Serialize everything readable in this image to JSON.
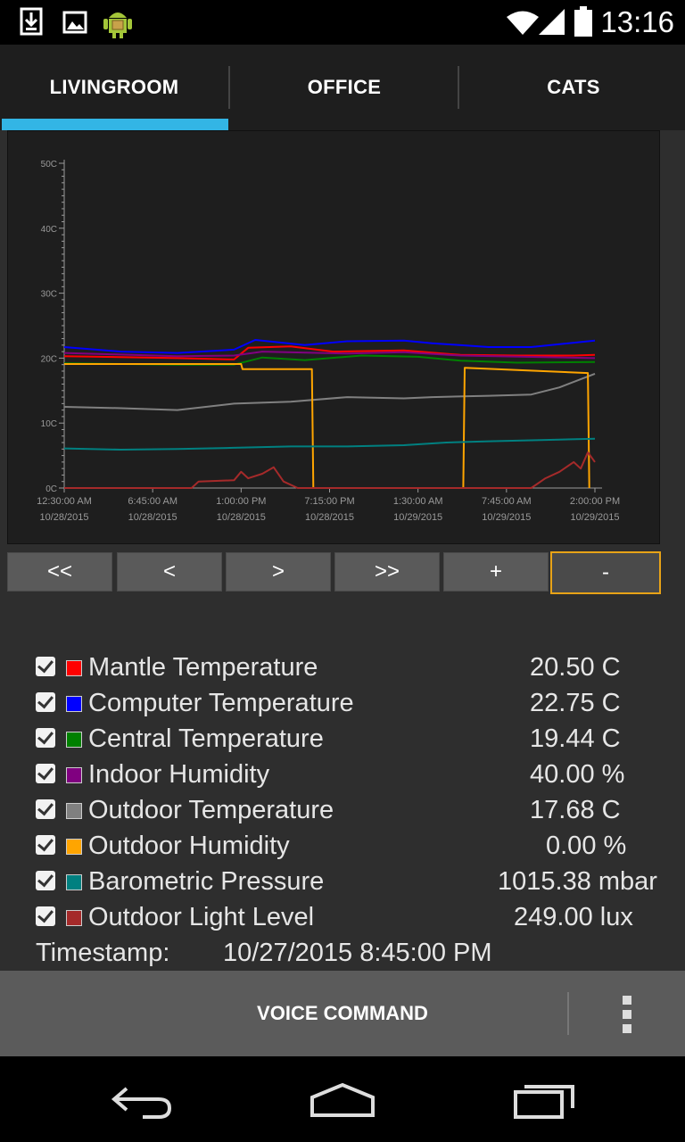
{
  "status_bar": {
    "time": "13:16",
    "left_icons": [
      "download-icon",
      "image-icon",
      "android-icon"
    ],
    "right_icons": [
      "wifi-icon",
      "signal-icon",
      "battery-icon"
    ]
  },
  "tabs": [
    {
      "label": "LIVINGROOM",
      "selected": true
    },
    {
      "label": "OFFICE",
      "selected": false
    },
    {
      "label": "CATS",
      "selected": false
    }
  ],
  "accent_color": "#33b5e5",
  "chart_data": {
    "type": "line",
    "ylim": [
      0,
      50
    ],
    "y_ticks": [
      "0C",
      "10C",
      "20C",
      "30C",
      "40C",
      "50C"
    ],
    "x_ticks": [
      [
        "12:30:00 AM",
        "10/28/2015"
      ],
      [
        "6:45:00 AM",
        "10/28/2015"
      ],
      [
        "1:00:00 PM",
        "10/28/2015"
      ],
      [
        "7:15:00 PM",
        "10/28/2015"
      ],
      [
        "1:30:00 AM",
        "10/29/2015"
      ],
      [
        "7:45:00 AM",
        "10/29/2015"
      ],
      [
        "2:00:00 PM",
        "10/29/2015"
      ]
    ],
    "x_hours": [
      0,
      6.25,
      12.5,
      18.75,
      25,
      31.25,
      37.5
    ],
    "series": [
      {
        "name": "Mantle Temperature",
        "color": "#ff0000",
        "points": [
          [
            0,
            20.3
          ],
          [
            8,
            20
          ],
          [
            12,
            19.8
          ],
          [
            13,
            21.6
          ],
          [
            16,
            21.8
          ],
          [
            19,
            21
          ],
          [
            24,
            21.2
          ],
          [
            28,
            20.5
          ],
          [
            32,
            20.4
          ],
          [
            36,
            20.4
          ],
          [
            37.5,
            20.5
          ]
        ]
      },
      {
        "name": "Computer Temperature",
        "color": "#0000ff",
        "points": [
          [
            0,
            21.7
          ],
          [
            4,
            21
          ],
          [
            8,
            20.8
          ],
          [
            12,
            21.3
          ],
          [
            13.5,
            22.8
          ],
          [
            17,
            22
          ],
          [
            20,
            22.6
          ],
          [
            24,
            22.7
          ],
          [
            26,
            22.3
          ],
          [
            30,
            21.7
          ],
          [
            33,
            21.7
          ],
          [
            37.5,
            22.7
          ]
        ]
      },
      {
        "name": "Central Temperature",
        "color": "#008000",
        "points": [
          [
            0,
            19.2
          ],
          [
            8,
            19
          ],
          [
            12,
            19
          ],
          [
            14,
            20.1
          ],
          [
            17,
            19.7
          ],
          [
            21,
            20.4
          ],
          [
            25,
            20.2
          ],
          [
            28,
            19.6
          ],
          [
            32,
            19.3
          ],
          [
            37.5,
            19.4
          ]
        ]
      },
      {
        "name": "Indoor Humidity",
        "color": "#800080",
        "points": [
          [
            0,
            20.8
          ],
          [
            8,
            20.3
          ],
          [
            12,
            20.4
          ],
          [
            14,
            21
          ],
          [
            20,
            20.7
          ],
          [
            24,
            20.9
          ],
          [
            28,
            20.4
          ],
          [
            37.5,
            20
          ]
        ]
      },
      {
        "name": "Outdoor Temperature",
        "color": "#808080",
        "points": [
          [
            0,
            12.5
          ],
          [
            4,
            12.3
          ],
          [
            8,
            12
          ],
          [
            12,
            13
          ],
          [
            16,
            13.3
          ],
          [
            20,
            14
          ],
          [
            24,
            13.8
          ],
          [
            26,
            14
          ],
          [
            30,
            14.2
          ],
          [
            33,
            14.4
          ],
          [
            35,
            15.5
          ],
          [
            37.5,
            17.6
          ]
        ]
      },
      {
        "name": "Outdoor Humidity",
        "color": "#ffa500",
        "points": [
          [
            0,
            19.1
          ],
          [
            12.5,
            19.1
          ],
          [
            12.6,
            18.3
          ],
          [
            17.5,
            18.3
          ],
          [
            17.6,
            0
          ],
          [
            28.2,
            0
          ],
          [
            28.3,
            18.5
          ],
          [
            37,
            17.7
          ],
          [
            37.1,
            0
          ]
        ]
      },
      {
        "name": "Barometric Pressure",
        "color": "#008080",
        "points": [
          [
            0,
            6.1
          ],
          [
            4,
            5.9
          ],
          [
            8,
            6
          ],
          [
            12,
            6.2
          ],
          [
            16,
            6.4
          ],
          [
            20,
            6.4
          ],
          [
            24,
            6.6
          ],
          [
            27,
            7
          ],
          [
            30,
            7.2
          ],
          [
            34,
            7.4
          ],
          [
            37.5,
            7.6
          ]
        ]
      },
      {
        "name": "Outdoor Light Level",
        "color": "#a52a2a",
        "points": [
          [
            0,
            0
          ],
          [
            9,
            0
          ],
          [
            9.5,
            1
          ],
          [
            12,
            1.2
          ],
          [
            12.5,
            2.5
          ],
          [
            13,
            1.5
          ],
          [
            14,
            2.2
          ],
          [
            14.8,
            3.2
          ],
          [
            15.5,
            1
          ],
          [
            16.5,
            0
          ],
          [
            33,
            0
          ],
          [
            34,
            1.5
          ],
          [
            35,
            2.5
          ],
          [
            36,
            4
          ],
          [
            36.5,
            3
          ],
          [
            37,
            5.5
          ],
          [
            37.5,
            4
          ]
        ]
      }
    ]
  },
  "nav_buttons": [
    {
      "label": "<<",
      "active": false
    },
    {
      "label": "<",
      "active": false
    },
    {
      "label": ">",
      "active": false
    },
    {
      "label": ">>",
      "active": false
    },
    {
      "label": "+",
      "active": false
    },
    {
      "label": "-",
      "active": true
    }
  ],
  "legend": [
    {
      "name": "Mantle Temperature",
      "value": "20.50 C",
      "color": "#ff0000",
      "checked": true
    },
    {
      "name": "Computer Temperature",
      "value": "22.75 C",
      "color": "#0000ff",
      "checked": true
    },
    {
      "name": "Central Temperature",
      "value": "19.44 C",
      "color": "#008000",
      "checked": true
    },
    {
      "name": "Indoor Humidity",
      "value": "40.00 %",
      "color": "#800080",
      "checked": true
    },
    {
      "name": "Outdoor Temperature",
      "value": "17.68 C",
      "color": "#808080",
      "checked": true
    },
    {
      "name": "Outdoor Humidity",
      "value": "0.00 %",
      "color": "#ffa500",
      "checked": true
    },
    {
      "name": "Barometric Pressure",
      "value": "1015.38 mbar",
      "color": "#008080",
      "checked": true
    },
    {
      "name": "Outdoor Light Level",
      "value": "249.00 lux",
      "color": "#a52a2a",
      "checked": true
    }
  ],
  "timestamp": {
    "label": "Timestamp:",
    "value": "10/27/2015 8:45:00 PM"
  },
  "bottom_bar": {
    "voice_command": "VOICE COMMAND",
    "overflow_icon": "overflow-menu-icon"
  },
  "nav_bar": {
    "icons": [
      "back-icon",
      "home-icon",
      "recents-icon"
    ]
  }
}
